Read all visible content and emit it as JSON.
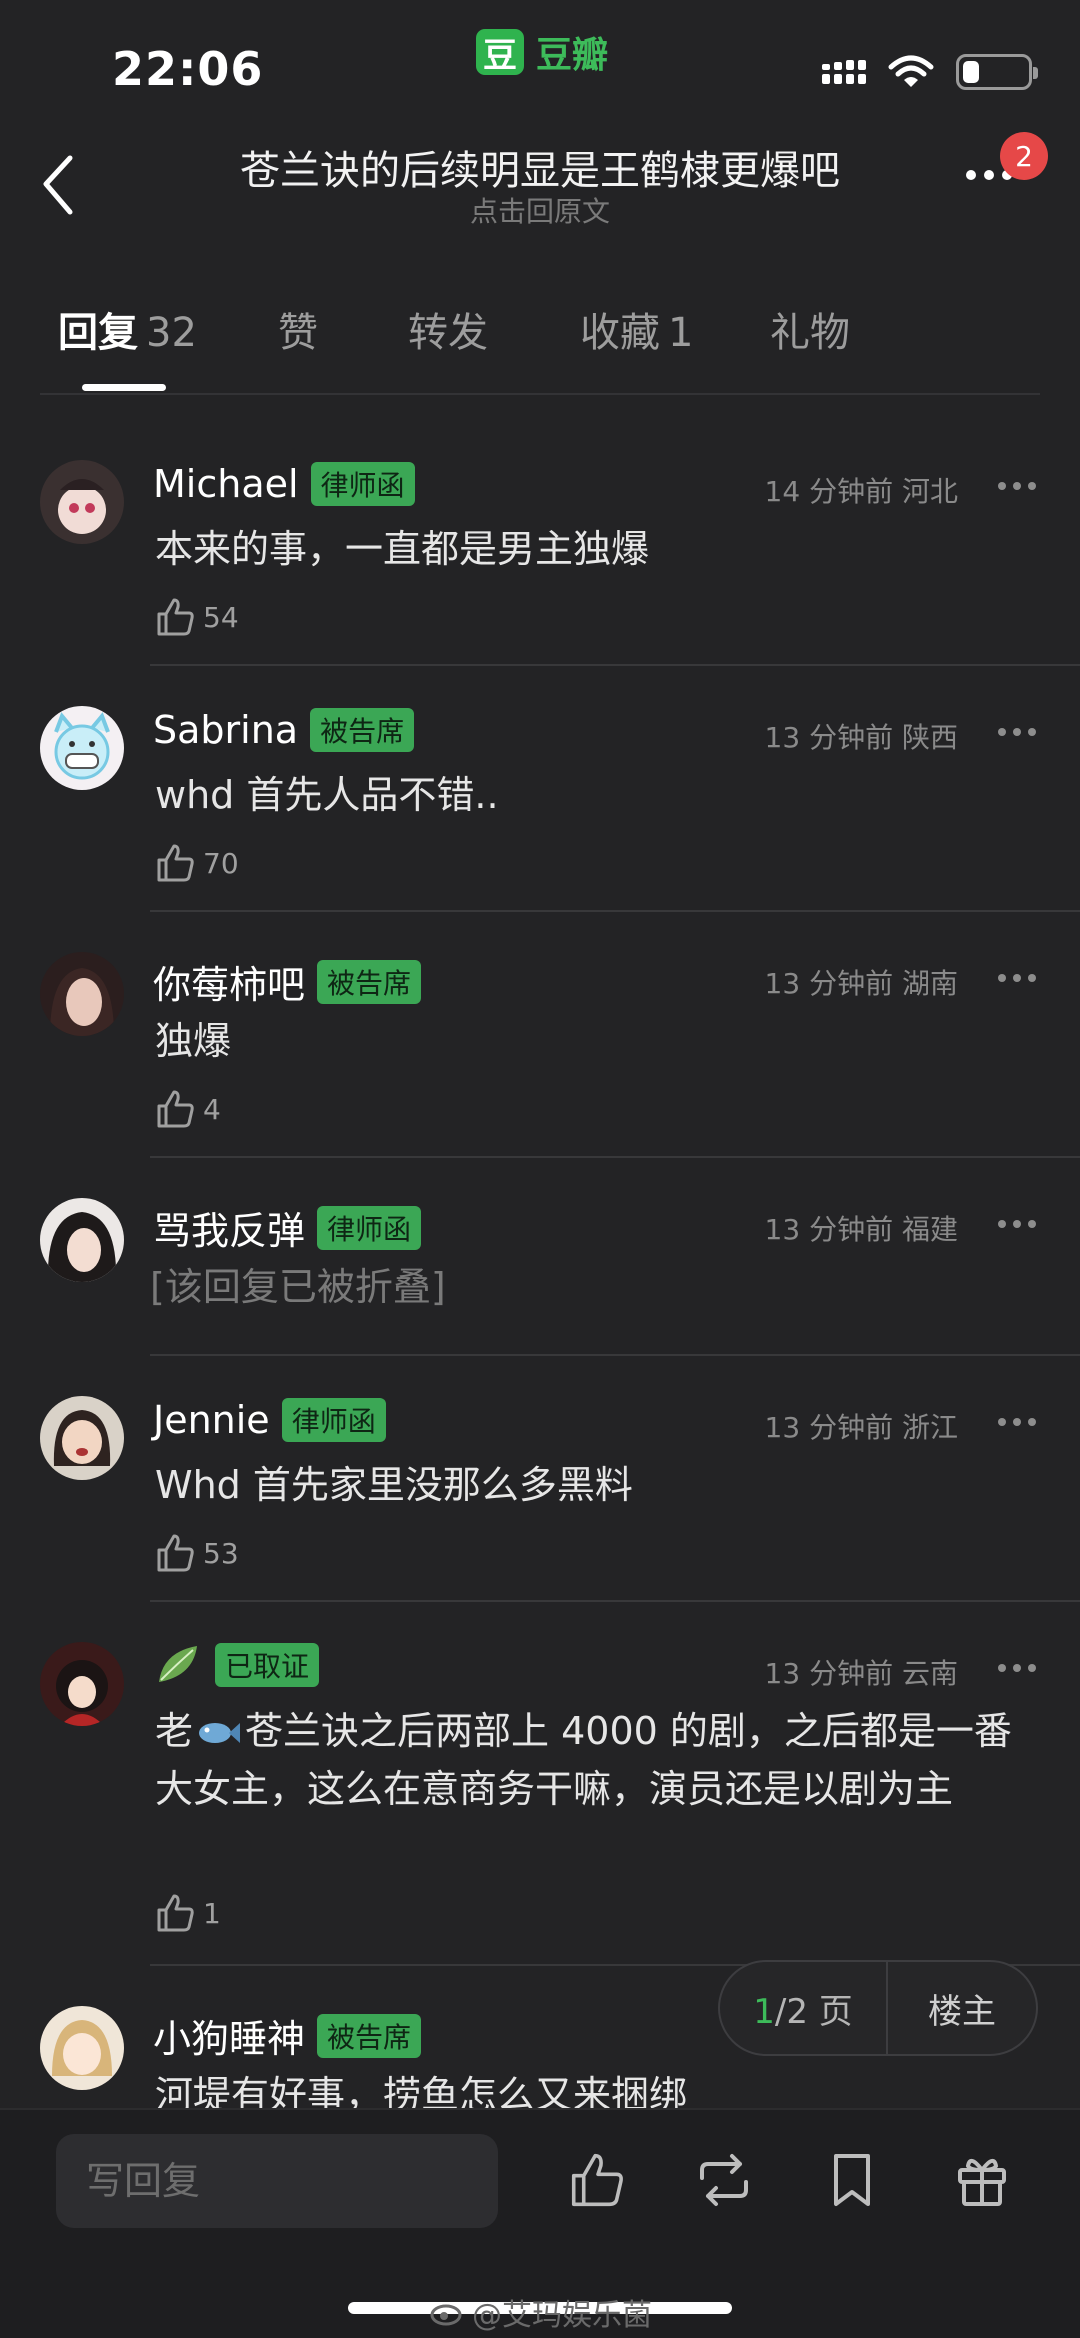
{
  "status_bar": {
    "time": "22:06",
    "app_logo_char": "豆",
    "app_name": "豆瓣",
    "battery_percent": 25
  },
  "header": {
    "title": "苍兰诀的后续明显是王鹤棣更爆吧",
    "subtitle": "点击回原文",
    "notification_count": "2"
  },
  "tabs": [
    {
      "label": "回复",
      "count": "32"
    },
    {
      "label": "赞",
      "count": ""
    },
    {
      "label": "转发",
      "count": ""
    },
    {
      "label": "收藏",
      "count": "1"
    },
    {
      "label": "礼物",
      "count": ""
    }
  ],
  "comments": [
    {
      "user": "Michael",
      "badge": "律师函",
      "time": "14 分钟前",
      "location": "河北",
      "text": "本来的事，一直都是男主独爆",
      "likes": "54"
    },
    {
      "user": "Sabrina",
      "badge": "被告席",
      "time": "13 分钟前",
      "location": "陕西",
      "text": "whd 首先人品不错..",
      "likes": "70"
    },
    {
      "user": "你莓柿吧",
      "badge": "被告席",
      "time": "13 分钟前",
      "location": "湖南",
      "text": "独爆",
      "likes": "4"
    },
    {
      "user": "骂我反弹",
      "badge": "律师函",
      "time": "13 分钟前",
      "location": "福建",
      "text": "[该回复已被折叠]",
      "likes": ""
    },
    {
      "user": "Jennie",
      "badge": "律师函",
      "time": "13 分钟前",
      "location": "浙江",
      "text": "Whd 首先家里没那么多黑料",
      "likes": "53"
    },
    {
      "user": "🌿",
      "badge": "已取证",
      "time": "13 分钟前",
      "location": "云南",
      "text_a": "老",
      "text_b": "苍兰诀之后两部上 4000 的剧，之后都是一番大女主，这么在意商务干嘛，演员还是以剧为主",
      "likes": "1"
    },
    {
      "user": "小狗睡神",
      "badge": "被告席",
      "time": "",
      "location": "",
      "text": "河堤有好事，捞鱼怎么又来捆绑",
      "likes": ""
    }
  ],
  "pager": {
    "current": "1",
    "rest": "/2 页",
    "owner_label": "楼主"
  },
  "bottom_bar": {
    "reply_placeholder": "写回复"
  },
  "watermark": {
    "text": "@艾玛娱乐菌"
  },
  "colors": {
    "accent_green": "#3dbb5a",
    "badge_green": "#3ba755",
    "notif_red": "#e64848",
    "background": "#232325"
  }
}
